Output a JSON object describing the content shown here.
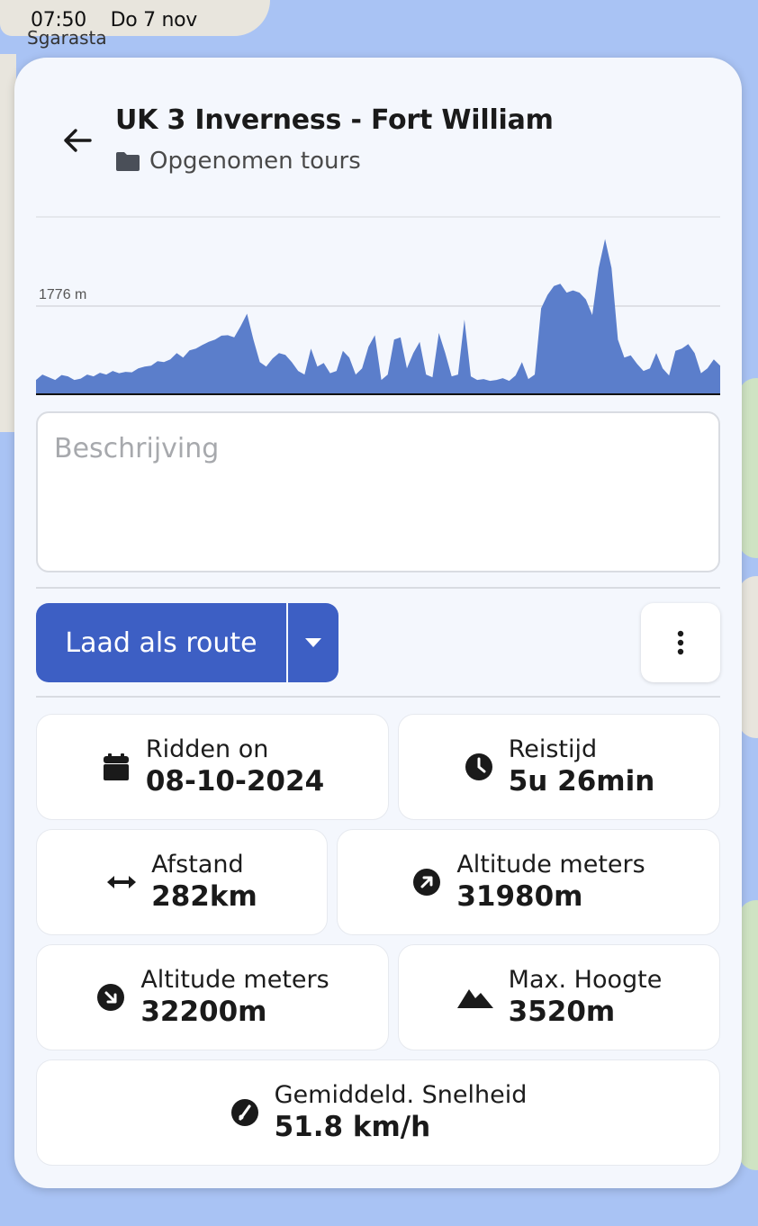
{
  "status_bar": {
    "time": "07:50",
    "date": "Do 7 nov"
  },
  "map": {
    "place_label": "Sgarasta"
  },
  "header": {
    "title": "UK 3 Inverness - Fort William",
    "folder": "Opgenomen tours"
  },
  "chart_data": {
    "type": "area",
    "marker_label": "1776 m",
    "color": "#5b7ecb",
    "values": [
      300,
      420,
      360,
      300,
      410,
      380,
      300,
      330,
      420,
      380,
      460,
      420,
      500,
      450,
      480,
      470,
      560,
      600,
      620,
      720,
      700,
      760,
      900,
      800,
      960,
      1000,
      1080,
      1150,
      1200,
      1290,
      1300,
      1250,
      1500,
      1780,
      1200,
      700,
      600,
      780,
      900,
      860,
      700,
      500,
      420,
      1000,
      600,
      680,
      450,
      500,
      950,
      800,
      420,
      560,
      1040,
      1300,
      300,
      420,
      1200,
      1250,
      560,
      900,
      1150,
      420,
      360,
      1350,
      900,
      380,
      420,
      1650,
      380,
      300,
      320,
      280,
      300,
      340,
      280,
      400,
      700,
      320,
      420,
      1900,
      2200,
      2400,
      2450,
      2250,
      2300,
      2250,
      2100,
      1750,
      2800,
      3450,
      2800,
      1200,
      800,
      850,
      660,
      500,
      560,
      900,
      560,
      400,
      950,
      1000,
      1100,
      900,
      450,
      560,
      760,
      620
    ]
  },
  "description": {
    "placeholder": "Beschrijving"
  },
  "actions": {
    "load_route": "Laad als route"
  },
  "stats": {
    "date": {
      "label": "Ridden on",
      "value": "08-10-2024"
    },
    "duration": {
      "label": "Reistijd",
      "value": "5u 26min"
    },
    "distance": {
      "label": "Afstand",
      "value": "282km"
    },
    "ascent": {
      "label": "Altitude meters",
      "value": "31980m"
    },
    "descent": {
      "label": "Altitude meters",
      "value": "32200m"
    },
    "max_height": {
      "label": "Max. Hoogte",
      "value": "3520m"
    },
    "avg_speed": {
      "label": "Gemiddeld. Snelheid",
      "value": "51.8 km/h"
    }
  }
}
